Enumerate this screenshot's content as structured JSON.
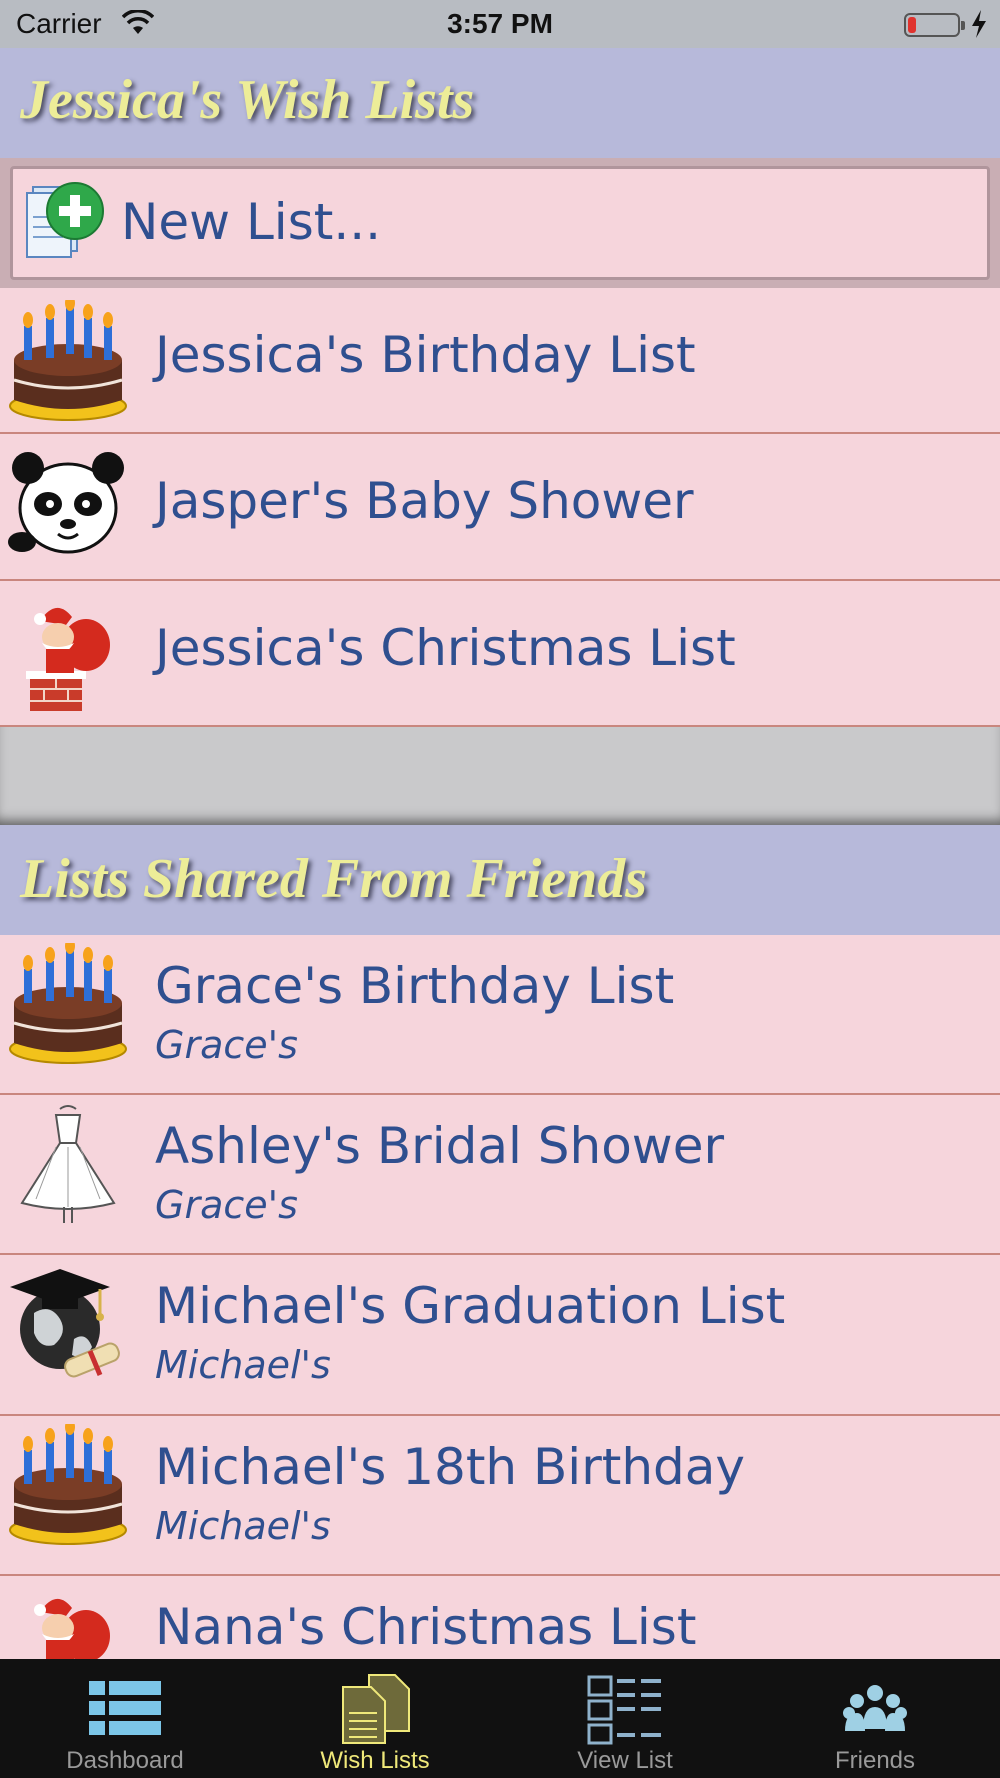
{
  "status_bar": {
    "carrier": "Carrier",
    "time": "3:57 PM"
  },
  "my_lists": {
    "header": "Jessica's Wish Lists",
    "new_list_label": "New List...",
    "items": [
      {
        "title": "Jessica's Birthday List",
        "icon": "birthday-cake-icon"
      },
      {
        "title": "Jasper's Baby Shower",
        "icon": "panda-icon"
      },
      {
        "title": "Jessica's Christmas List",
        "icon": "santa-icon"
      }
    ]
  },
  "shared_lists": {
    "header": "Lists Shared From Friends",
    "items": [
      {
        "title": "Grace's Birthday List",
        "owner": "Grace's",
        "icon": "birthday-cake-icon"
      },
      {
        "title": "Ashley's Bridal Shower",
        "owner": "Grace's",
        "icon": "wedding-dress-icon"
      },
      {
        "title": "Michael's Graduation List",
        "owner": "Michael's",
        "icon": "graduation-cap-icon"
      },
      {
        "title": "Michael's 18th Birthday",
        "owner": "Michael's",
        "icon": "birthday-cake-icon"
      },
      {
        "title": "Nana's Christmas List",
        "owner": "",
        "icon": "santa-icon"
      }
    ]
  },
  "tab_bar": {
    "tabs": [
      {
        "label": "Dashboard",
        "icon": "dashboard-icon",
        "active": false
      },
      {
        "label": "Wish Lists",
        "icon": "wish-lists-icon",
        "active": true
      },
      {
        "label": "View List",
        "icon": "view-list-icon",
        "active": false
      },
      {
        "label": "Friends",
        "icon": "friends-icon",
        "active": false
      }
    ]
  },
  "colors": {
    "header_bg": "#b7b9da",
    "header_text": "#eded98",
    "row_bg": "#f6d5dc",
    "row_text": "#2f4f8f",
    "row_divider": "#c9867e",
    "tab_bar_bg": "#111111",
    "tab_active": "#efe87a"
  }
}
